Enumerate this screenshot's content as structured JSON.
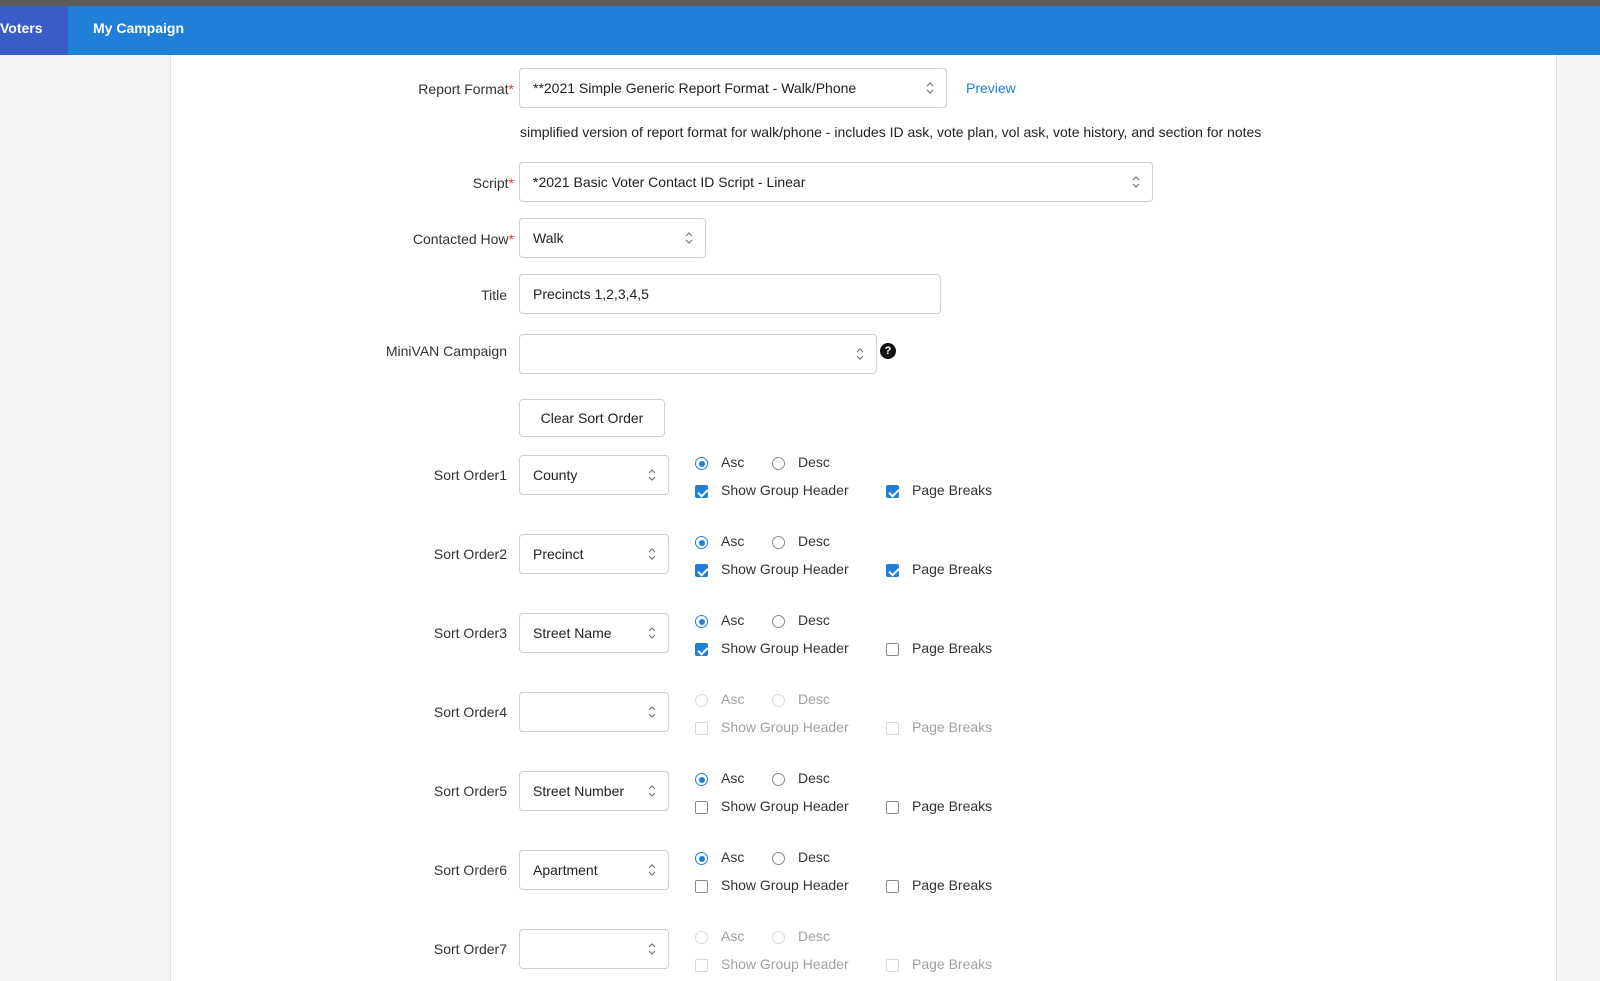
{
  "nav": {
    "voters_label": "Voters",
    "campaign_label": "My Campaign"
  },
  "form": {
    "report_format": {
      "label": "Report Format",
      "required_mark": "*",
      "value": "**2021 Simple Generic Report Format - Walk/Phone",
      "preview_label": "Preview",
      "description": "simplified version of report format for walk/phone - includes ID ask, vote plan, vol ask, vote history, and section for notes"
    },
    "script": {
      "label": "Script",
      "required_mark": "*",
      "value": "*2021 Basic Voter Contact ID Script - Linear"
    },
    "contacted_how": {
      "label": "Contacted How",
      "required_mark": "*",
      "value": "Walk"
    },
    "title": {
      "label": "Title",
      "value": "Precincts 1,2,3,4,5"
    },
    "minivan": {
      "label": "MiniVAN Campaign",
      "value": "",
      "help_icon": "?"
    },
    "clear_sort_label": "Clear Sort Order"
  },
  "sort_labels": {
    "asc": "Asc",
    "desc": "Desc",
    "group_header": "Show Group Header",
    "page_breaks": "Page Breaks"
  },
  "sort_orders": [
    {
      "label": "Sort Order1",
      "value": "County",
      "direction": "asc",
      "group_header": true,
      "page_breaks": true,
      "disabled": false
    },
    {
      "label": "Sort Order2",
      "value": "Precinct",
      "direction": "asc",
      "group_header": true,
      "page_breaks": true,
      "disabled": false
    },
    {
      "label": "Sort Order3",
      "value": "Street Name",
      "direction": "asc",
      "group_header": true,
      "page_breaks": false,
      "disabled": false
    },
    {
      "label": "Sort Order4",
      "value": "",
      "direction": "",
      "group_header": false,
      "page_breaks": false,
      "disabled": true
    },
    {
      "label": "Sort Order5",
      "value": "Street Number",
      "direction": "asc",
      "group_header": false,
      "page_breaks": false,
      "disabled": false
    },
    {
      "label": "Sort Order6",
      "value": "Apartment",
      "direction": "asc",
      "group_header": false,
      "page_breaks": false,
      "disabled": false
    },
    {
      "label": "Sort Order7",
      "value": "",
      "direction": "",
      "group_header": false,
      "page_breaks": false,
      "disabled": true
    }
  ],
  "colors": {
    "nav": "#1f7fd9",
    "nav_active": "#3a5cc9",
    "accent": "#1f7fd9",
    "required": "#dd3333"
  }
}
